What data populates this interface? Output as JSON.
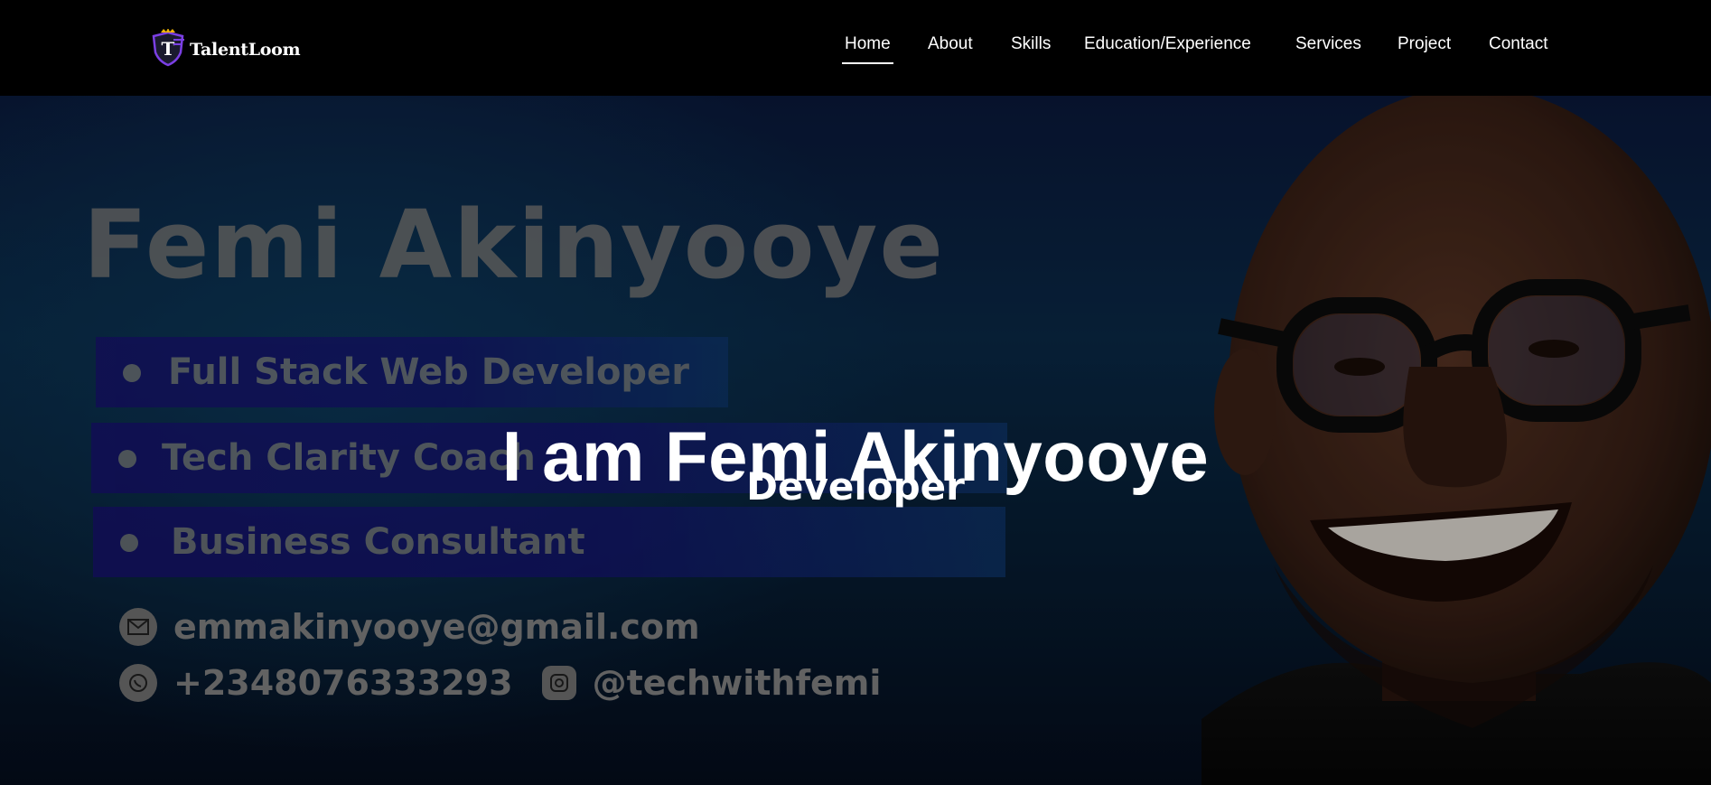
{
  "brand": {
    "name": "TalentLoom",
    "logo_icon": "shield-crown-logo"
  },
  "nav": {
    "items": [
      {
        "label": "Home",
        "active": true
      },
      {
        "label": "About",
        "active": false
      },
      {
        "label": "Skills",
        "active": false
      },
      {
        "label": "Education/Experience",
        "active": false
      },
      {
        "label": "Services",
        "active": false
      },
      {
        "label": "Project",
        "active": false
      },
      {
        "label": "Contact",
        "active": false
      }
    ]
  },
  "hero": {
    "headline": "I am Femi Akinyooye",
    "subheadline": "Developer",
    "background": {
      "name": "Femi Akinyooye",
      "roles": [
        "Full Stack Web Developer",
        "Tech Clarity Coach",
        "Business Consultant"
      ],
      "email": "emmakinyooye@gmail.com",
      "phone": "+2348076333293",
      "instagram": "@techwithfemi",
      "email_icon": "mail-icon",
      "phone_icon": "whatsapp-icon",
      "instagram_icon": "instagram-icon"
    }
  },
  "colors": {
    "navbar": "#000000",
    "role_bar": "#1a0f7a",
    "hero_bg": "#0a2b4a",
    "text": "#ffffff"
  }
}
